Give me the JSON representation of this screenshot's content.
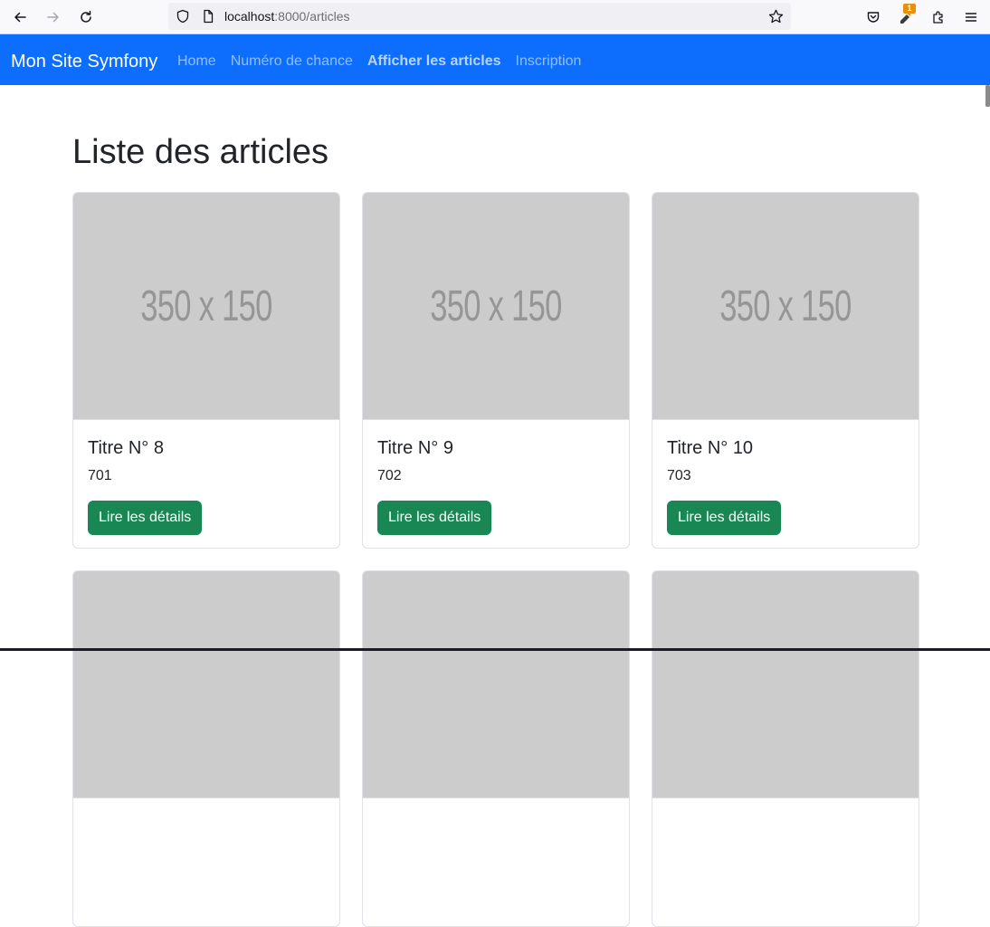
{
  "browser": {
    "url_host": "localhost",
    "url_path": ":8000/articles",
    "extension_badge": "1"
  },
  "navbar": {
    "brand": "Mon Site Symfony",
    "links": [
      {
        "label": "Home"
      },
      {
        "label": "Numéro de chance"
      },
      {
        "label": "Afficher les articles"
      },
      {
        "label": "Inscription"
      }
    ]
  },
  "page": {
    "title": "Liste des articles"
  },
  "articles": [
    {
      "placeholder": "350 x 150",
      "title": "Titre N° 8",
      "text": "701",
      "button": "Lire les détails"
    },
    {
      "placeholder": "350 x 150",
      "title": "Titre N° 9",
      "text": "702",
      "button": "Lire les détails"
    },
    {
      "placeholder": "350 x 150",
      "title": "Titre N° 10",
      "text": "703",
      "button": "Lire les détails"
    }
  ],
  "colors": {
    "navbar": "#0d6efd",
    "button": "#198754",
    "placeholder": "#cccccc"
  }
}
